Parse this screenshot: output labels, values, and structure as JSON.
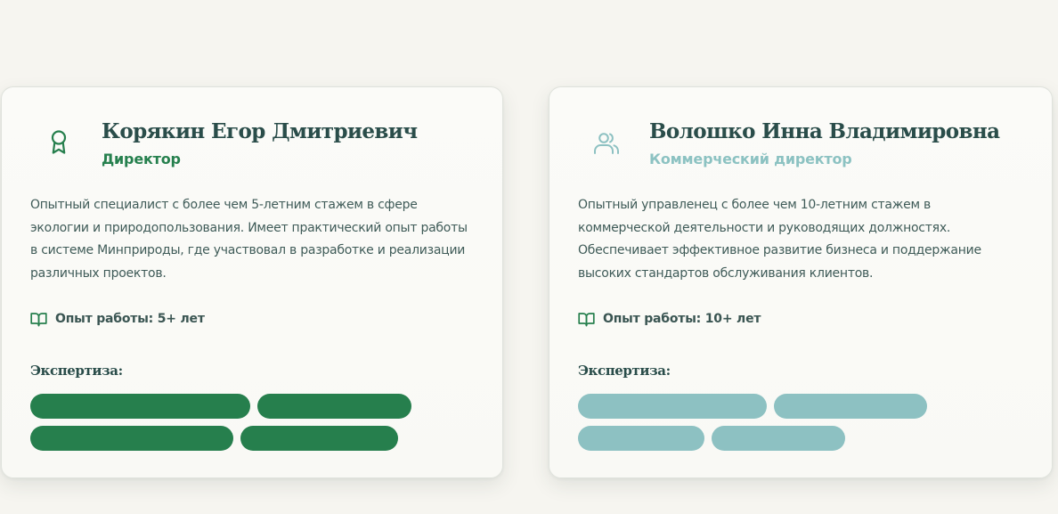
{
  "team": [
    {
      "name": "Корякин Егор Дмитриевич",
      "role": "Директор",
      "icon": "award-icon",
      "accent_color": "#267f4d",
      "description": "Опытный специалист с более чем 5-летним стажем в сфере экологии и природопользования. Имеет практический опыт работы в системе Минприроды, где участвовал в разработке и реализации различных проектов.",
      "experience_icon": "book-open-icon",
      "experience": "Опыт работы: 5+ лет",
      "expertise_heading": "Экспертиза:",
      "expertise_tags": [
        "",
        "",
        "",
        ""
      ]
    },
    {
      "name": "Волошко Инна Владимировна",
      "role": "Коммерческий директор",
      "icon": "users-icon",
      "accent_color": "#8dc1c2",
      "description": "Опытный управленец с более чем 10-летним стажем в коммерческой деятельности и руководящих должностях. Обеспечивает эффективное развитие бизнеса и поддержание высоких стандартов обслуживания клиентов.",
      "experience_icon": "book-open-icon",
      "experience": "Опыт работы: 10+ лет",
      "expertise_heading": "Экспертиза:",
      "expertise_tags": [
        "",
        "",
        "",
        ""
      ]
    }
  ]
}
